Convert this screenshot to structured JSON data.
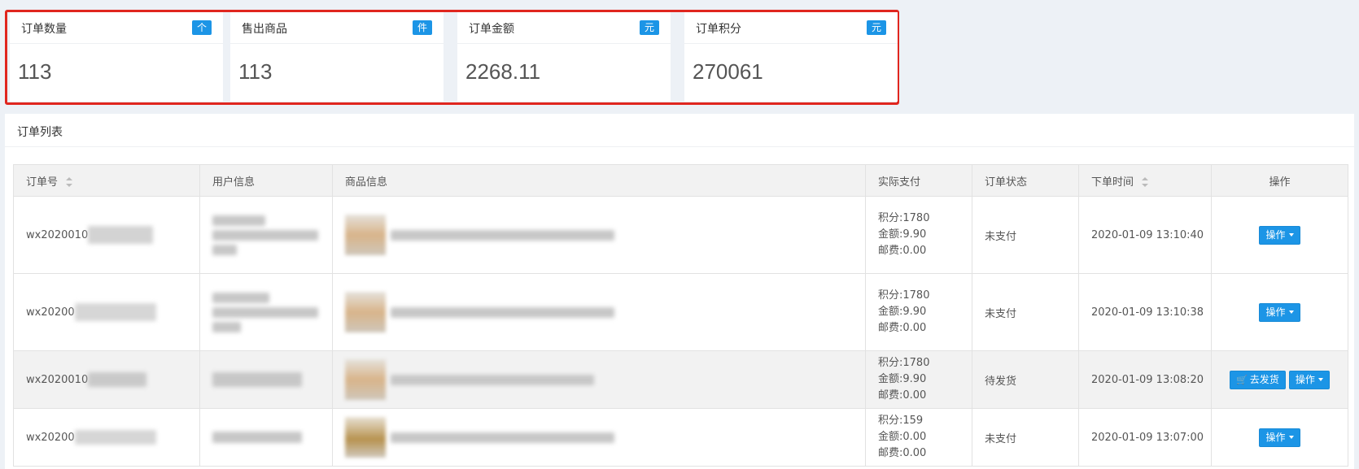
{
  "stats": [
    {
      "title": "订单数量",
      "badge": "个",
      "value": "113"
    },
    {
      "title": "售出商品",
      "badge": "件",
      "value": "113"
    },
    {
      "title": "订单金额",
      "badge": "元",
      "value": "2268.11"
    },
    {
      "title": "订单积分",
      "badge": "元",
      "value": "270061"
    }
  ],
  "panel": {
    "title": "订单列表"
  },
  "table": {
    "headers": {
      "order_no": "订单号",
      "user": "用户信息",
      "goods": "商品信息",
      "pay": "实际支付",
      "status": "订单状态",
      "time": "下单时间",
      "action": "操作"
    },
    "rows": [
      {
        "order_prefix": "wx2020010",
        "points": "积分:1780",
        "amount": "金额:9.90",
        "shipping": "邮费:0.00",
        "status": "未支付",
        "time": "2020-01-09 13:10:40",
        "action_label": "操作",
        "ship_label": ""
      },
      {
        "order_prefix": "wx20200",
        "points": "积分:1780",
        "amount": "金额:9.90",
        "shipping": "邮费:0.00",
        "status": "未支付",
        "time": "2020-01-09 13:10:38",
        "action_label": "操作",
        "ship_label": ""
      },
      {
        "order_prefix": "wx2020010",
        "points": "积分:1780",
        "amount": "金额:9.90",
        "shipping": "邮费:0.00",
        "status": "待发货",
        "time": "2020-01-09 13:08:20",
        "action_label": "操作",
        "ship_label": "去发货"
      },
      {
        "order_prefix": "wx20200",
        "points": "积分:159",
        "amount": "金额:0.00",
        "shipping": "邮费:0.00",
        "status": "未支付",
        "time": "2020-01-09 13:07:00",
        "action_label": "操作",
        "ship_label": ""
      }
    ]
  },
  "colors": {
    "accent": "#1c95e6",
    "highlight_border": "#e0261f"
  },
  "icons": {
    "sort": "sort-icon",
    "cart": "cart-icon",
    "dropdown": "caret-down-icon"
  }
}
